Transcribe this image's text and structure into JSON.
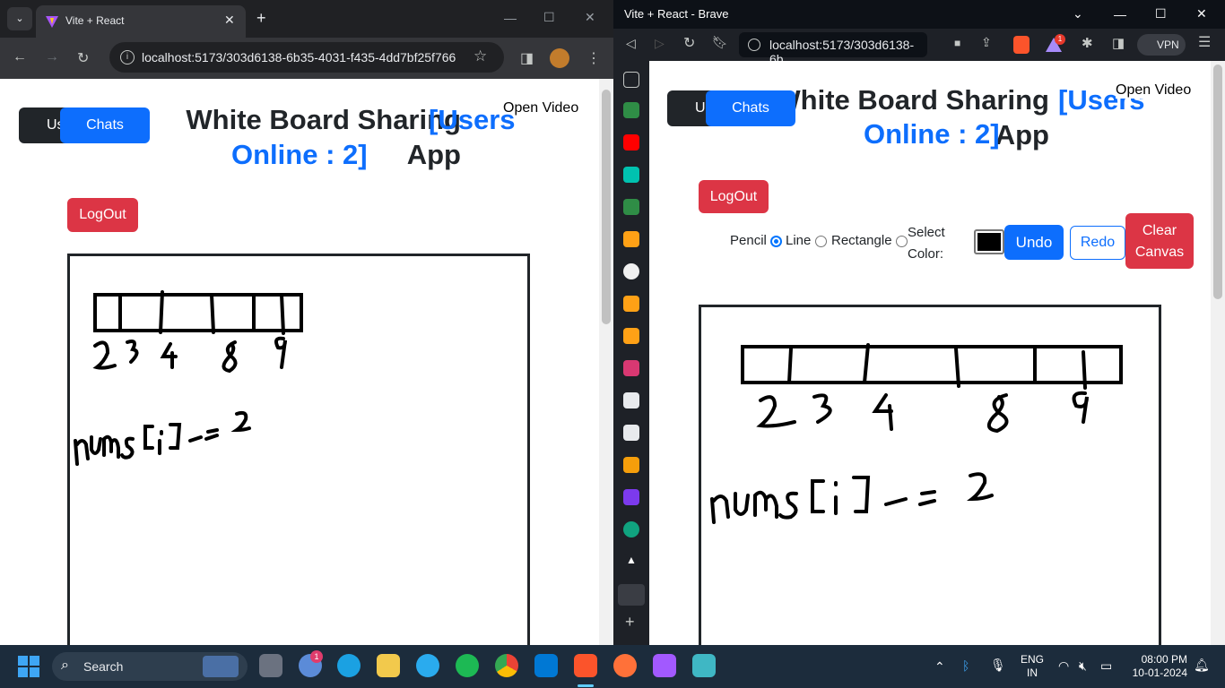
{
  "left_window": {
    "tab_title": "Vite + React",
    "url": "localhost:5173/303d6138-6b35-4031-f435-4dd7bf25f766",
    "app": {
      "users_label": "Users",
      "chats_label": "Chats",
      "heading_prefix": "White Board Sharing App",
      "heading_users": "[Users Online : 2]",
      "open_video": "Open Video",
      "logout_label": "LogOut"
    }
  },
  "right_window": {
    "title": "Vite + React - Brave",
    "url": "localhost:5173/303d6138-6b...",
    "vpn_label": "VPN",
    "badge_count": "1",
    "app": {
      "users_label": "Users",
      "chats_label": "Chats",
      "heading_prefix": "White Board Sharing App",
      "heading_users": "[Users Online : 2]",
      "open_video": "Open Video",
      "logout_label": "LogOut",
      "tools": {
        "pencil": "Pencil",
        "line": "Line",
        "rectangle": "Rectangle",
        "select_color": "Select Color:",
        "selected_tool": "pencil",
        "color_value": "#000000"
      },
      "undo_label": "Undo",
      "redo_label": "Redo",
      "clear_label": "Clear Canvas"
    }
  },
  "taskbar": {
    "search_placeholder": "Search",
    "language": "ENG",
    "region": "IN",
    "time": "08:00 PM",
    "date": "10-01-2024",
    "notification_badge": "1"
  },
  "drawing": {
    "digits": [
      "2",
      "3",
      "4",
      "8",
      "9"
    ],
    "expression": "nums[i] -= 2"
  }
}
